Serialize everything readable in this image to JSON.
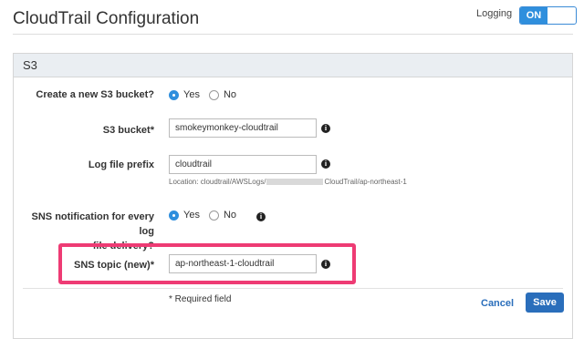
{
  "header": {
    "title": "CloudTrail Configuration",
    "logging_label": "Logging",
    "toggle_label": "ON"
  },
  "panel": {
    "title": "S3",
    "create_bucket": {
      "label": "Create a new S3 bucket?",
      "options": [
        "Yes",
        "No"
      ],
      "selected": "Yes"
    },
    "s3_bucket": {
      "label": "S3 bucket*",
      "value": "smokeymonkey-cloudtrail"
    },
    "log_prefix": {
      "label": "Log file prefix",
      "value": "cloudtrail",
      "hint_prefix": "Location: cloudtrail/AWSLogs/",
      "hint_suffix": "CloudTrail/ap-northeast-1"
    },
    "sns_notify": {
      "label_line1": "SNS notification for every log",
      "label_line2": "file delivery?",
      "options": [
        "Yes",
        "No"
      ],
      "selected": "Yes"
    },
    "sns_topic": {
      "label": "SNS topic (new)*",
      "value": "ap-northeast-1-cloudtrail"
    },
    "footer": {
      "required_note": "* Required field",
      "cancel_label": "Cancel",
      "save_label": "Save"
    }
  },
  "colors": {
    "accent": "#2f8fdd",
    "highlight": "#ee3b74",
    "button": "#2a6ebb"
  },
  "icons": [
    "info-icon"
  ]
}
